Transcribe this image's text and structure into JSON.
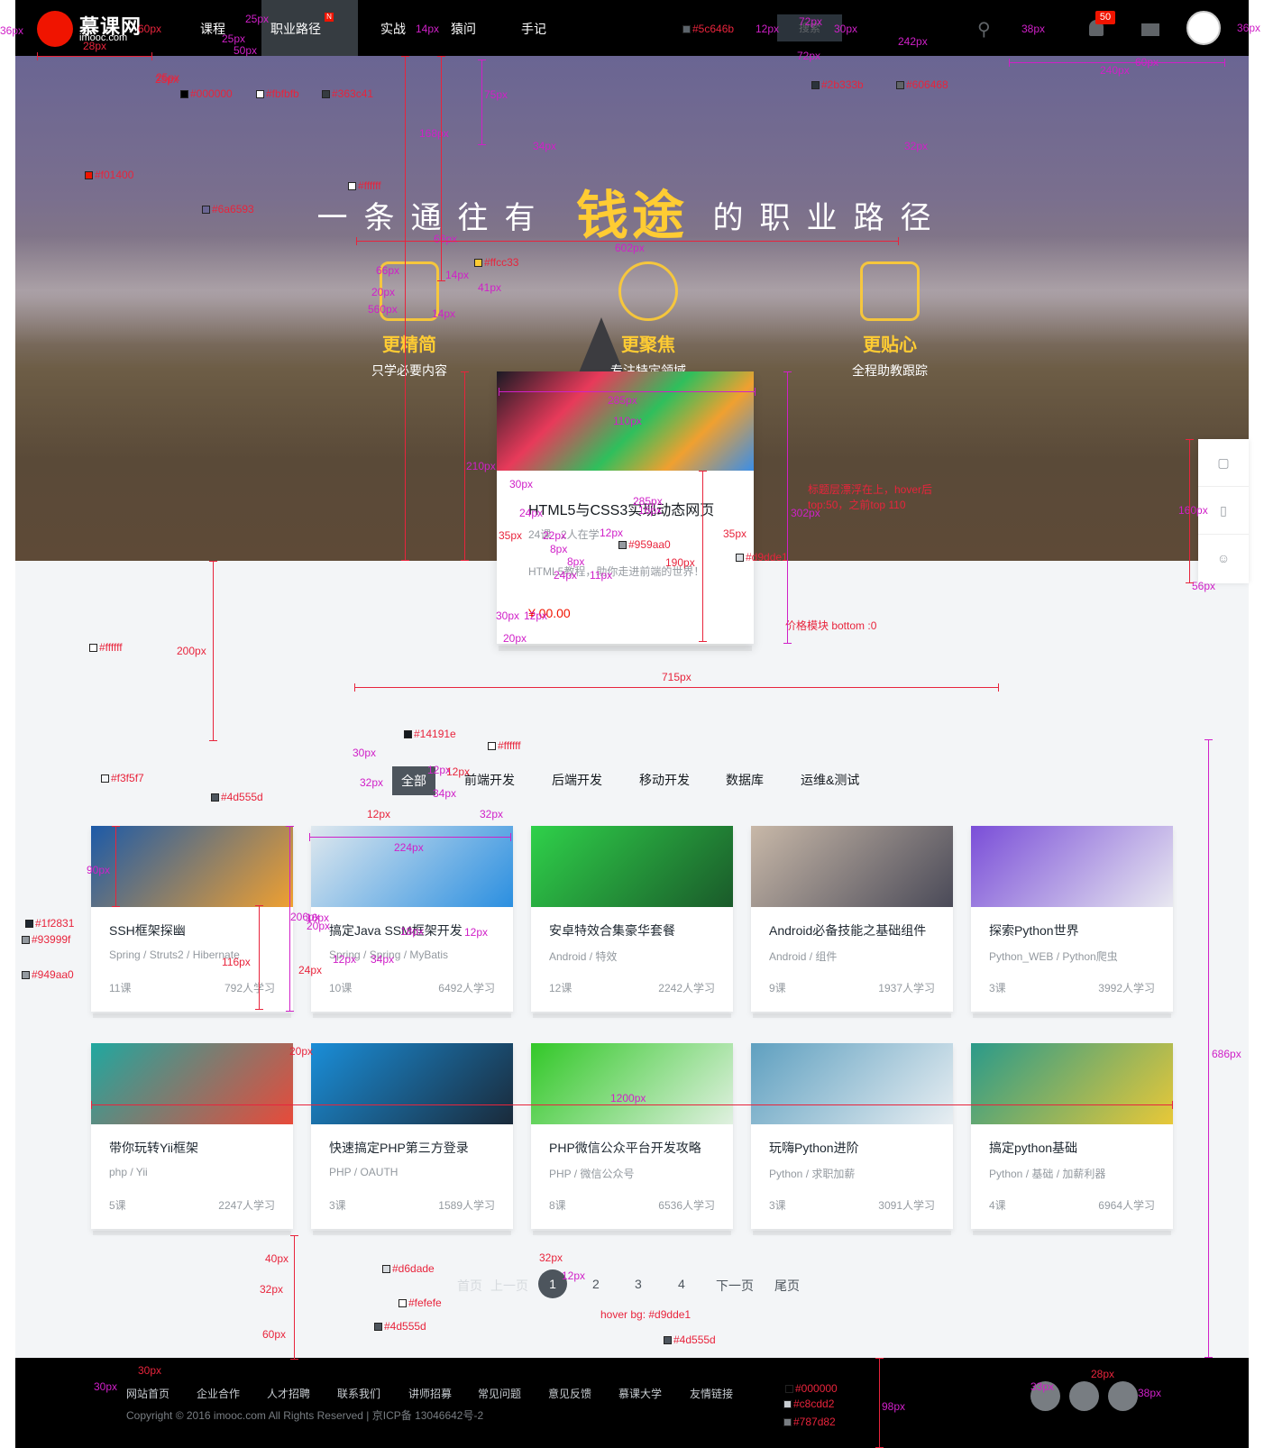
{
  "header": {
    "logo_text": "慕课网",
    "logo_sub": "imooc.com",
    "nav": [
      "课程",
      "职业路径",
      "实战",
      "猿问",
      "手记"
    ],
    "nav_badge": "N",
    "search_placeholder": "搜索",
    "message_count": "50"
  },
  "banner": {
    "slogan_pre": "一条通往有",
    "slogan_big": "钱途",
    "slogan_post": "的职业路径",
    "features": [
      {
        "title": "更精简",
        "subtitle": "只学必要内容"
      },
      {
        "title": "更聚焦",
        "subtitle": "专注特定领域"
      },
      {
        "title": "更贴心",
        "subtitle": "全程助教跟踪"
      }
    ]
  },
  "featured": {
    "title": "HTML5与CSS3实现动态网页",
    "meta": "24课 · 2人在学",
    "desc": "HTML5教程，助你走进前端的世界！",
    "price": "¥ 00.00",
    "note": "标题层漂浮在上，hover后 top:50，之前top 110",
    "price_note": "价格模块 bottom :0"
  },
  "tabs": [
    "全部",
    "前端开发",
    "后端开发",
    "移动开发",
    "数据库",
    "运维&测试"
  ],
  "courses": [
    {
      "name": "SSH框架探幽",
      "tags": "Spring / Struts2 / Hibernate",
      "lessons": "11课",
      "students": "792人学习",
      "c1": "#1c5aa8",
      "c2": "#f0a030"
    },
    {
      "name": "搞定Java SSM框架开发",
      "tags": "Spring / Spring / MyBatis",
      "lessons": "10课",
      "students": "6492人学习",
      "c1": "#dfe8ee",
      "c2": "#2b8fe0"
    },
    {
      "name": "安卓特效合集豪华套餐",
      "tags": "Android / 特效",
      "lessons": "12课",
      "students": "2242人学习",
      "c1": "#2fd14a",
      "c2": "#1a5a2a"
    },
    {
      "name": "Android必备技能之基础组件",
      "tags": "Android / 组件",
      "lessons": "9课",
      "students": "1937人学习",
      "c1": "#c8b8a8",
      "c2": "#4a4a58"
    },
    {
      "name": "探索Python世界",
      "tags": "Python_WEB / Python爬虫",
      "lessons": "3课",
      "students": "3992人学习",
      "c1": "#7a4ed8",
      "c2": "#e8e8f0"
    },
    {
      "name": "带你玩转Yii框架",
      "tags": "php / Yii",
      "lessons": "5课",
      "students": "2247人学习",
      "c1": "#1fa8a0",
      "c2": "#e84a3a"
    },
    {
      "name": "快速搞定PHP第三方登录",
      "tags": "PHP / OAUTH",
      "lessons": "3课",
      "students": "1589人学习",
      "c1": "#1a8ed8",
      "c2": "#1a2a3a"
    },
    {
      "name": "PHP微信公众平台开发攻略",
      "tags": "PHP / 微信公众号",
      "lessons": "8课",
      "students": "6536人学习",
      "c1": "#32c828",
      "c2": "#e0f0e0"
    },
    {
      "name": "玩嗨Python进阶",
      "tags": "Python / 求职加薪",
      "lessons": "3课",
      "students": "3091人学习",
      "c1": "#5fa0c0",
      "c2": "#e8eef2"
    },
    {
      "name": "搞定python基础",
      "tags": "Python / 基础 / 加薪利器",
      "lessons": "4课",
      "students": "6964人学习",
      "c1": "#2a9a8a",
      "c2": "#e8c838"
    }
  ],
  "pagination": {
    "first": "首页",
    "prev": "上一页",
    "pages": [
      "1",
      "2",
      "3",
      "4"
    ],
    "next": "下一页",
    "last": "尾页",
    "hover_note": "hover  bg: #d9dde1"
  },
  "footer": {
    "links": [
      "网站首页",
      "企业合作",
      "人才招聘",
      "联系我们",
      "讲师招募",
      "常见问题",
      "意见反馈",
      "慕课大学",
      "友情链接"
    ],
    "copyright": "Copyright © 2016 imooc.com All Rights Reserved | 京ICP备 13046642号-2"
  },
  "colors": {
    "brand_red": "#f01400",
    "header_bg": "#000000",
    "nav_active": "#363c41",
    "accent_yellow": "#ffcc33",
    "page_bg": "#f3f5f7",
    "tab_active": "#4d555d",
    "title_text": "#14191e",
    "muted_text": "#959aa0"
  },
  "annotations": {
    "colors": [
      "#000000",
      "#fbfbfb",
      "#363c41",
      "#f01400",
      "#ffffff",
      "#6a6593",
      "#5c646b",
      "#2b333b",
      "#606468",
      "#ffcc33",
      "#959aa0",
      "#d9dde1",
      "#ffffff",
      "#f3f5f7",
      "#4d555d",
      "#14191e",
      "#ffffff",
      "#1f2831",
      "#93999f",
      "#949aa0",
      "#d6dade",
      "#fefefe",
      "#4d555d",
      "#4d555d",
      "#000000",
      "#c8cdd2",
      "#787d82"
    ],
    "sizes": [
      "36px",
      "28px",
      "60px",
      "25px",
      "25px",
      "25px",
      "50px",
      "25px",
      "14px",
      "12px",
      "72px",
      "30px",
      "242px",
      "72px",
      "38px",
      "36px",
      "60px",
      "240px",
      "75px",
      "168px",
      "34px",
      "32px",
      "66px",
      "66px",
      "602px",
      "14px",
      "41px",
      "20px",
      "560px",
      "14px",
      "285px",
      "110px",
      "210px",
      "30px",
      "285px",
      "24px",
      "16px",
      "35px",
      "22px",
      "12px",
      "35px",
      "8px",
      "8px",
      "190px",
      "24px",
      "11px",
      "302px",
      "160px",
      "30px",
      "12px",
      "20px",
      "56px",
      "200px",
      "715px",
      "30px",
      "12px",
      "32px",
      "12px",
      "34px",
      "32px",
      "12px",
      "224px",
      "90px",
      "206px",
      "16px",
      "20px",
      "18px",
      "12px",
      "116px",
      "12px",
      "34px",
      "24px",
      "20px",
      "1200px",
      "686px",
      "40px",
      "32px",
      "12px",
      "32px",
      "60px",
      "30px",
      "30px",
      "28px",
      "98px",
      "33px",
      "38px"
    ]
  }
}
